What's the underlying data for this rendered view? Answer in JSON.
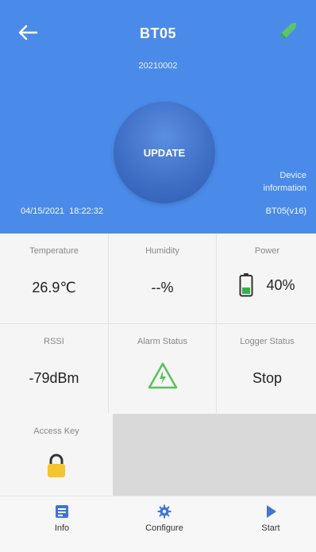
{
  "header": {
    "title": "BT05",
    "serial": "20210002",
    "update_label": "UPDATE",
    "device_info_label": "Device\ninformation",
    "timestamp": "04/15/2021  18:22:32",
    "version": "BT05(v16)"
  },
  "metrics": [
    {
      "label": "Temperature",
      "value": "26.9℃"
    },
    {
      "label": "Humidity",
      "value": "--%"
    },
    {
      "label": "Power",
      "value": "40%",
      "level": 0.4
    },
    {
      "label": "RSSI",
      "value": "-79dBm"
    },
    {
      "label": "Alarm Status",
      "icon": "warning-icon"
    },
    {
      "label": "Logger Status",
      "value": "Stop"
    }
  ],
  "access_key": {
    "label": "Access Key",
    "icon": "lock-icon"
  },
  "nav": {
    "info_label": "Info",
    "configure_label": "Configure",
    "start_label": "Start"
  },
  "colors": {
    "header_bg": "#4a8be9",
    "nav_accent": "#3f74d8",
    "battery_green": "#33b14a",
    "warning_green": "#58c35a",
    "lock_yellow": "#f2c531"
  }
}
